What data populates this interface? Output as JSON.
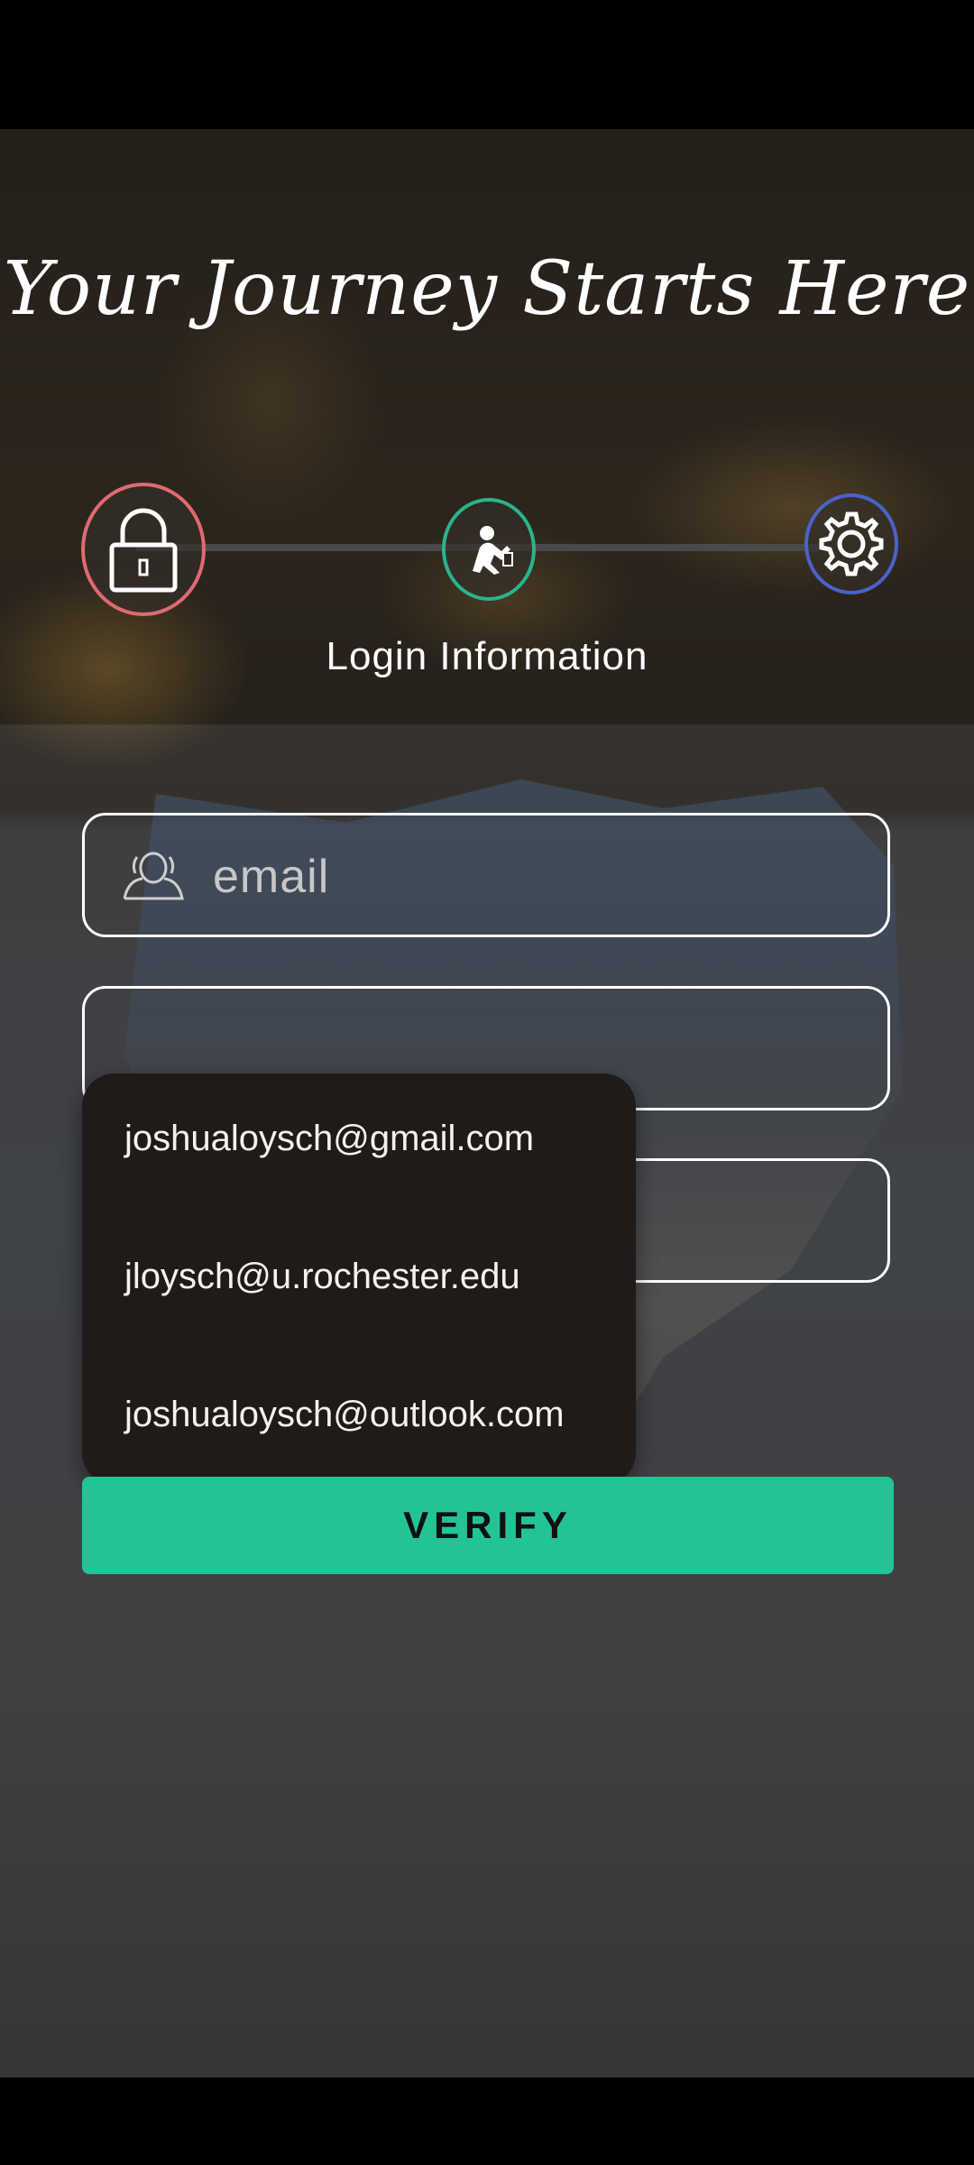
{
  "header": {
    "title": "Your Journey Starts Here"
  },
  "steps": {
    "current_label": "Login Information",
    "items": [
      {
        "icon": "lock-icon",
        "color": "#e06a72"
      },
      {
        "icon": "fitness-person-icon",
        "color": "#2bb38c"
      },
      {
        "icon": "gear-icon",
        "color": "#4a63c8"
      }
    ]
  },
  "form": {
    "email_placeholder": "email",
    "email_value": ""
  },
  "autocomplete": {
    "options": [
      "joshualoysch@gmail.com",
      "jloysch@u.rochester.edu",
      "joshualoysch@outlook.com"
    ]
  },
  "actions": {
    "verify_label": "VERIFY",
    "accent_color": "#22c497"
  },
  "navbar": {
    "icons": [
      "recents-square-icon",
      "home-circle-icon",
      "back-triangle-icon"
    ]
  }
}
